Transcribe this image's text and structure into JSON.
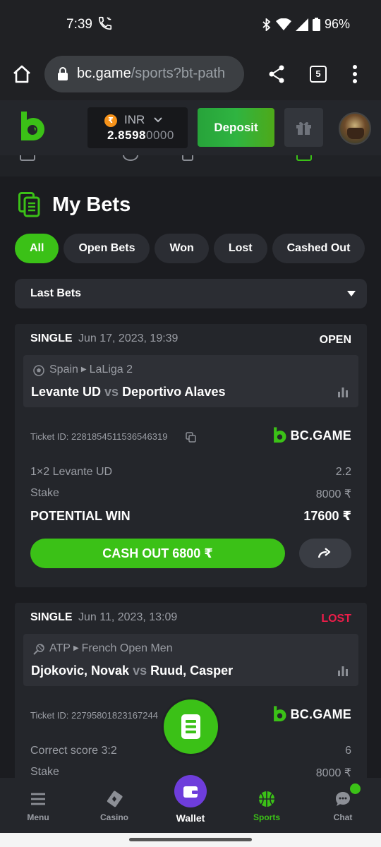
{
  "status_bar": {
    "time": "7:39",
    "battery": "96%"
  },
  "browser": {
    "url_host": "bc.game",
    "url_path": "/sports?bt-path",
    "tab_count": "5"
  },
  "header": {
    "currency": "INR",
    "currency_symbol": "₹",
    "balance_main": "2.8598",
    "balance_faded": "0000",
    "deposit_label": "Deposit"
  },
  "page": {
    "title": "My Bets",
    "filters": [
      "All",
      "Open Bets",
      "Won",
      "Lost",
      "Cashed Out"
    ],
    "active_filter": "All",
    "select_value": "Last Bets"
  },
  "bets": [
    {
      "type": "SINGLE",
      "date": "Jun 17, 2023, 19:39",
      "status": "OPEN",
      "country": "Spain",
      "league": "LaLiga 2",
      "home": "Levante UD",
      "vs": "vs",
      "away": "Deportivo Alaves",
      "ticket": "Ticket ID: 2281854511536546319",
      "brand": "BC.GAME",
      "selection_label": "1×2 Levante UD",
      "selection_odds": "2.2",
      "stake_label": "Stake",
      "stake_value": "8000 ₹",
      "potential_label": "POTENTIAL WIN",
      "potential_value": "17600 ₹",
      "cashout_label": "CASH OUT 6800 ₹"
    },
    {
      "type": "SINGLE",
      "date": "Jun 11, 2023, 13:09",
      "status": "LOST",
      "country": "ATP",
      "league": "French Open Men",
      "home": "Djokovic, Novak",
      "vs": "vs",
      "away": "Ruud, Casper",
      "ticket": "Ticket ID: 22795801823167244",
      "brand": "BC.GAME",
      "selection_label": "Correct score 3:2",
      "selection_odds": "6",
      "stake_label": "Stake",
      "stake_value": "8000 ₹"
    }
  ],
  "bottom_nav": {
    "menu": "Menu",
    "casino": "Casino",
    "wallet": "Wallet",
    "sports": "Sports",
    "chat": "Chat"
  },
  "colors": {
    "accent_green": "#3bc117",
    "lost_red": "#ed1d49",
    "wallet_purple": "#6e3ddb"
  }
}
